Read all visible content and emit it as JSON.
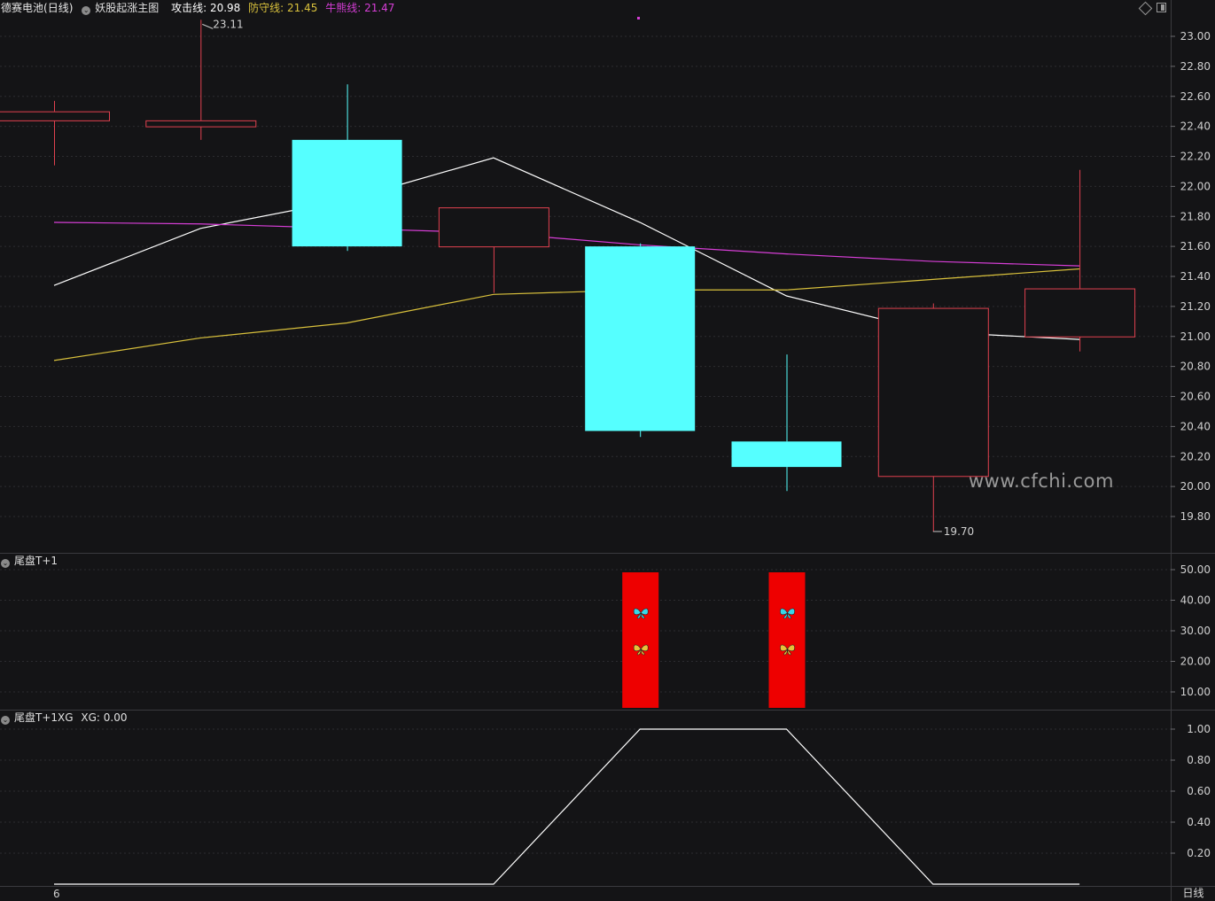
{
  "header": {
    "stock": "德赛电池",
    "period": "(日线)",
    "indicator": "妖股起涨主图",
    "attack_label": "攻击线:",
    "attack_value": "20.98",
    "defense_label": "防守线:",
    "defense_value": "21.45",
    "bull_label": "牛熊线:",
    "bull_value": "21.47"
  },
  "sub1": {
    "title": "尾盘T+1"
  },
  "sub2": {
    "title": "尾盘T+1XG",
    "xg_label": "XG:",
    "xg_value": "0.00"
  },
  "bottom": {
    "x_tick": "6",
    "period_button": "日线"
  },
  "watermark": "www.cfchi.com",
  "annotations": {
    "high": "23.11",
    "low": "19.70"
  },
  "colors": {
    "up": "#e0414f",
    "down": "#55ffff",
    "attack": "#ffffff",
    "defense": "#d9c13c",
    "bull": "#d63ed6",
    "signal": "#ee0000"
  },
  "chart_data": [
    {
      "type": "candlestick",
      "title": "德赛电池 (日线) 妖股起涨主图",
      "ylim": [
        19.6,
        23.2
      ],
      "y_ticks": [
        "23.00",
        "22.80",
        "22.60",
        "22.40",
        "22.20",
        "22.00",
        "21.80",
        "21.60",
        "21.40",
        "21.20",
        "21.00",
        "20.80",
        "20.60",
        "20.40",
        "20.20",
        "20.00",
        "19.80"
      ],
      "candles": [
        {
          "open": 22.44,
          "close": 22.5,
          "high": 22.57,
          "low": 22.14
        },
        {
          "open": 22.4,
          "close": 22.44,
          "high": 23.11,
          "low": 22.31
        },
        {
          "open": 22.31,
          "close": 21.6,
          "high": 22.68,
          "low": 21.57
        },
        {
          "open": 21.6,
          "close": 21.86,
          "high": 21.86,
          "low": 21.29
        },
        {
          "open": 21.6,
          "close": 20.37,
          "high": 21.62,
          "low": 20.33
        },
        {
          "open": 20.3,
          "close": 20.13,
          "high": 20.88,
          "low": 19.97
        },
        {
          "open": 20.07,
          "close": 21.19,
          "high": 21.22,
          "low": 19.7
        },
        {
          "open": 21.0,
          "close": 21.32,
          "high": 22.11,
          "low": 20.9
        }
      ],
      "series": [
        {
          "name": "攻击线",
          "values": [
            21.34,
            21.72,
            21.91,
            22.19,
            21.76,
            21.27,
            21.03,
            20.98
          ]
        },
        {
          "name": "防守线",
          "values": [
            20.84,
            20.99,
            21.09,
            21.28,
            21.31,
            21.31,
            21.38,
            21.45
          ]
        },
        {
          "name": "牛熊线",
          "values": [
            21.76,
            21.75,
            21.72,
            21.69,
            21.61,
            21.55,
            21.5,
            21.47
          ]
        }
      ]
    },
    {
      "type": "bar",
      "title": "尾盘T+1",
      "ylim": [
        5,
        55
      ],
      "y_ticks": [
        "50.00",
        "40.00",
        "30.00",
        "20.00",
        "10.00"
      ],
      "values": [
        0,
        0,
        0,
        0,
        50,
        50,
        0,
        0
      ]
    },
    {
      "type": "line",
      "title": "尾盘T+1XG",
      "ylim": [
        0,
        1.1
      ],
      "y_ticks": [
        "1.00",
        "0.80",
        "0.60",
        "0.40",
        "0.20"
      ],
      "series": [
        {
          "name": "XG",
          "values": [
            0,
            0,
            0,
            0,
            1,
            1,
            0,
            0
          ]
        }
      ]
    }
  ]
}
